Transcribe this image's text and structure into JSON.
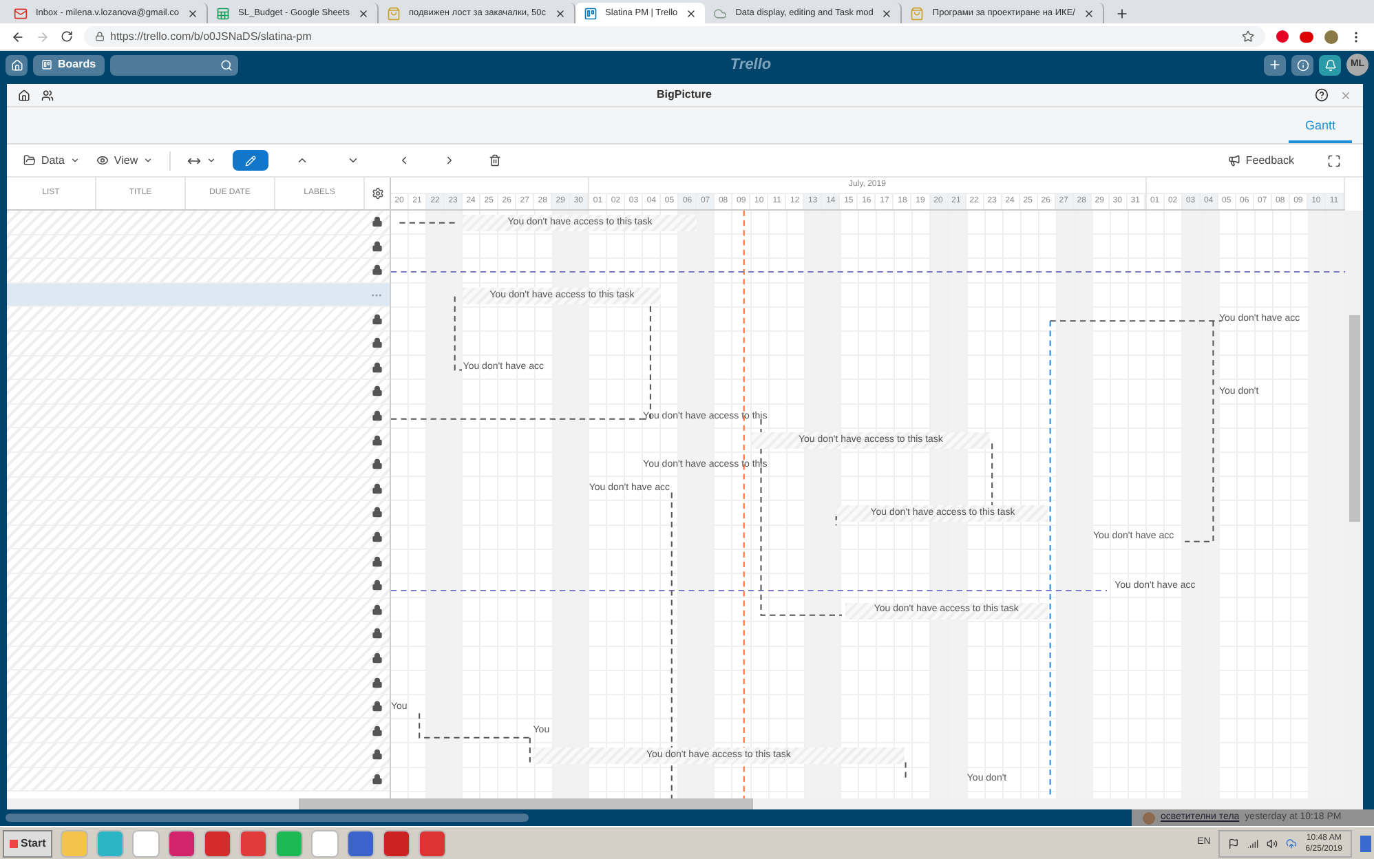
{
  "browser": {
    "tabs": [
      {
        "title": "Inbox - milena.v.lozanova@gmail.co",
        "kind": "mail",
        "selected": false
      },
      {
        "title": "SL_Budget - Google Sheets",
        "kind": "sheet",
        "selected": false
      },
      {
        "title": "подвижен лост за закачалки, 50с",
        "kind": "shop",
        "selected": false
      },
      {
        "title": "Slatina PM | Trello",
        "kind": "board",
        "selected": true
      },
      {
        "title": "Data display, editing and Task mod",
        "kind": "cloud",
        "selected": false
      },
      {
        "title": "Програми за проектиране на ИКЕ/",
        "kind": "shop",
        "selected": false
      }
    ],
    "url": "https://trello.com/b/o0JSNaDS/slatina-pm"
  },
  "trello": {
    "boards": "Boards",
    "logo": "Trello",
    "avatar": "ML"
  },
  "dialog": {
    "title": "BigPicture",
    "tabs": [
      {
        "label": "Gantt",
        "selected": true
      }
    ]
  },
  "toolbar": {
    "data": "Data",
    "view": "View",
    "edit_selected": true,
    "feedback": "Feedback"
  },
  "columns": [
    "LIST",
    "TITLE",
    "DUE DATE",
    "LABELS"
  ],
  "months": [
    {
      "days": [
        {
          "label": "20",
          "weekend": false
        },
        {
          "label": "21",
          "weekend": false
        },
        {
          "label": "22",
          "weekend": true
        },
        {
          "label": "23",
          "weekend": true
        },
        {
          "label": "24",
          "weekend": false
        },
        {
          "label": "25",
          "weekend": false
        },
        {
          "label": "26",
          "weekend": false
        },
        {
          "label": "27",
          "weekend": false
        },
        {
          "label": "28",
          "weekend": false
        },
        {
          "label": "29",
          "weekend": true
        },
        {
          "label": "30",
          "weekend": true
        }
      ]
    },
    {
      "label": "July, 2019",
      "days": [
        {
          "label": "01",
          "weekend": false
        },
        {
          "label": "02",
          "weekend": false
        },
        {
          "label": "03",
          "weekend": false
        },
        {
          "label": "04",
          "weekend": false
        },
        {
          "label": "05",
          "weekend": false
        },
        {
          "label": "06",
          "weekend": true
        },
        {
          "label": "07",
          "weekend": true
        },
        {
          "label": "08",
          "weekend": false
        },
        {
          "label": "09",
          "weekend": false
        },
        {
          "label": "10",
          "weekend": false
        },
        {
          "label": "11",
          "weekend": false
        },
        {
          "label": "12",
          "weekend": false
        },
        {
          "label": "13",
          "weekend": true
        },
        {
          "label": "14",
          "weekend": true
        },
        {
          "label": "15",
          "weekend": false
        },
        {
          "label": "16",
          "weekend": false
        },
        {
          "label": "17",
          "weekend": false
        },
        {
          "label": "18",
          "weekend": false
        },
        {
          "label": "19",
          "weekend": false
        },
        {
          "label": "20",
          "weekend": true
        },
        {
          "label": "21",
          "weekend": true
        },
        {
          "label": "22",
          "weekend": false
        },
        {
          "label": "23",
          "weekend": false
        },
        {
          "label": "24",
          "weekend": false
        },
        {
          "label": "25",
          "weekend": false
        },
        {
          "label": "26",
          "weekend": false
        },
        {
          "label": "27",
          "weekend": true
        },
        {
          "label": "28",
          "weekend": true
        },
        {
          "label": "29",
          "weekend": false
        },
        {
          "label": "30",
          "weekend": false
        },
        {
          "label": "31",
          "weekend": false
        }
      ]
    },
    {
      "days": [
        {
          "label": "01",
          "weekend": false
        },
        {
          "label": "02",
          "weekend": false
        },
        {
          "label": "03",
          "weekend": true
        },
        {
          "label": "04",
          "weekend": true
        },
        {
          "label": "05",
          "weekend": false
        },
        {
          "label": "06",
          "weekend": false
        },
        {
          "label": "07",
          "weekend": false
        },
        {
          "label": "08",
          "weekend": false
        },
        {
          "label": "09",
          "weekend": false
        },
        {
          "label": "10",
          "weekend": true
        },
        {
          "label": "11",
          "weekend": true
        }
      ]
    }
  ],
  "rows": [
    {
      "selected": false,
      "task": "You don't have access to this task"
    },
    {
      "selected": false
    },
    {
      "selected": false
    },
    {
      "selected": true,
      "task": "You don't have access to this task"
    },
    {
      "selected": false,
      "task": "You don't have acc"
    },
    {
      "selected": false
    },
    {
      "selected": false,
      "task": "You don't have acc"
    },
    {
      "selected": false,
      "task": "You don't"
    },
    {
      "selected": false,
      "task": "You don't have access to this"
    },
    {
      "selected": false,
      "task": "You don't have access to this task"
    },
    {
      "selected": false,
      "task": "You don't have access to this"
    },
    {
      "selected": false,
      "task": "You don't have acc"
    },
    {
      "selected": false,
      "task": "You don't have access to this task"
    },
    {
      "selected": false,
      "task": "You don't have acc"
    },
    {
      "selected": false
    },
    {
      "selected": false,
      "task": "You don't have acc"
    },
    {
      "selected": false,
      "task": "You don't have access to this task"
    },
    {
      "selected": false
    },
    {
      "selected": false
    },
    {
      "selected": false
    },
    {
      "selected": false,
      "task": "You"
    },
    {
      "selected": false,
      "task": "You"
    },
    {
      "selected": false,
      "task": "You don't have access to this task"
    },
    {
      "selected": false,
      "task": "You don't"
    }
  ],
  "notification": {
    "link": "осветителни тела",
    "time": "yesterday at 10:18 PM"
  },
  "taskbar": {
    "start": "Start",
    "language": "EN",
    "time": "10:48 AM",
    "date": "6/25/2019"
  }
}
